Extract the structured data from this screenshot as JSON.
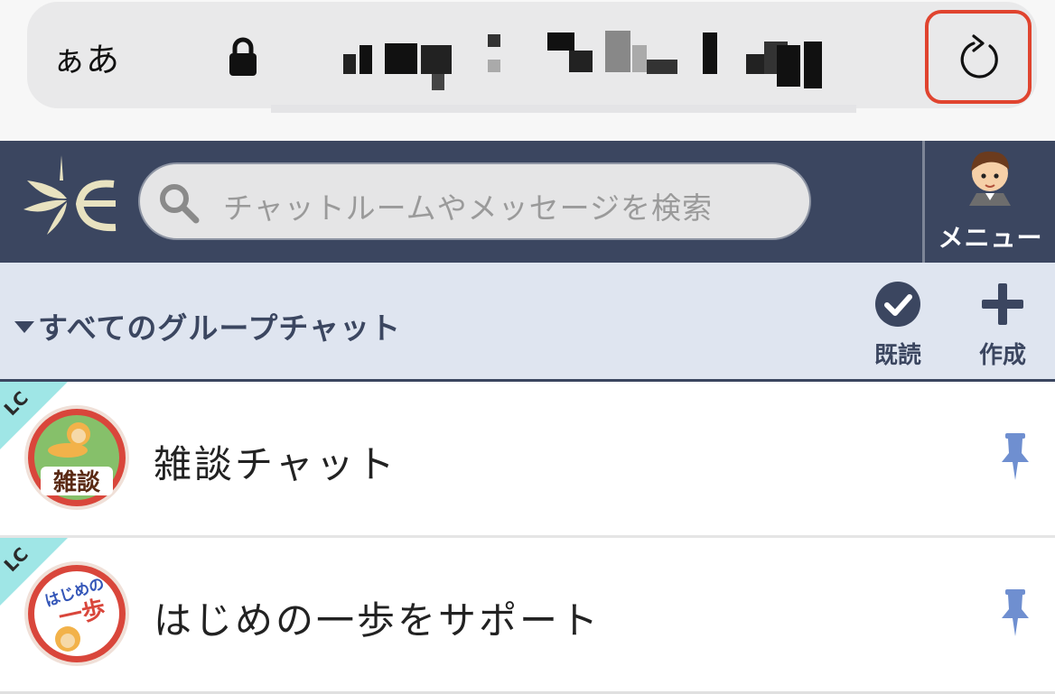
{
  "browser": {
    "text_size_label": "ぁあ"
  },
  "header": {
    "search_placeholder": "チャットルームやメッセージを検索",
    "menu_label": "メニュー"
  },
  "section": {
    "title": "すべてのグループチャット",
    "read_all_label": "既読",
    "create_label": "作成"
  },
  "rooms": [
    {
      "name": "雑談チャット",
      "badge": "LC",
      "icon_text": "雑談",
      "pinned": true
    },
    {
      "name": "はじめの一歩をサポート",
      "badge": "LC",
      "icon_text_top": "はじめの",
      "icon_text_bottom": "一歩",
      "pinned": true
    }
  ],
  "colors": {
    "header_bg": "#3b4660",
    "section_bg": "#dfe5f0",
    "pin": "#6f8fd0",
    "badge": "#9fe6e6",
    "highlight": "#e0442f"
  }
}
